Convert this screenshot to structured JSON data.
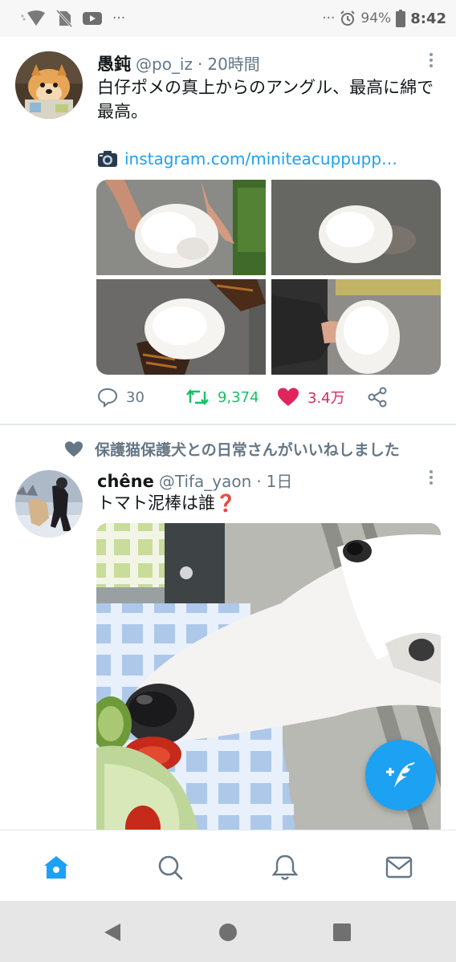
{
  "status_bar": {
    "left_more": "···",
    "right_more": "···",
    "battery": "94%",
    "time": "8:42"
  },
  "icons": {
    "wifi": "wifi-icon",
    "no_sim": "no-sim-icon",
    "youtube": "youtube-icon",
    "alarm": "alarm-icon",
    "battery": "battery-icon",
    "camera": "camera-icon",
    "reply": "reply-icon",
    "retweet": "retweet-icon",
    "like": "heart-icon",
    "share": "share-icon",
    "compose": "compose-tweet-icon",
    "home": "home-icon",
    "search": "search-icon",
    "notifications": "bell-icon",
    "messages": "mail-icon",
    "back": "back-icon",
    "home_nav": "home-nav-icon",
    "recents": "recents-icon"
  },
  "colors": {
    "accent": "#1da1f2",
    "retweet": "#17bf63",
    "like": "#e0245e",
    "muted": "#657786"
  },
  "tweets": [
    {
      "name": "愚鈍",
      "handle": "@po_iz",
      "separator": "·",
      "time": "20時間",
      "text": "白仔ポメの真上からのアングル、最高に綿で最高。",
      "link": "instagram.com/miniteacuppupp…",
      "reply_count": "30",
      "retweet_count": "9,374",
      "like_count": "3.4万",
      "liked": true
    },
    {
      "liked_by_text": "保護猫保護犬との日常さんがいいねしました",
      "name": "chêne",
      "handle": "@Tifa_yaon",
      "separator": "·",
      "time": "1日",
      "text": "トマト泥棒は誰❓"
    }
  ]
}
